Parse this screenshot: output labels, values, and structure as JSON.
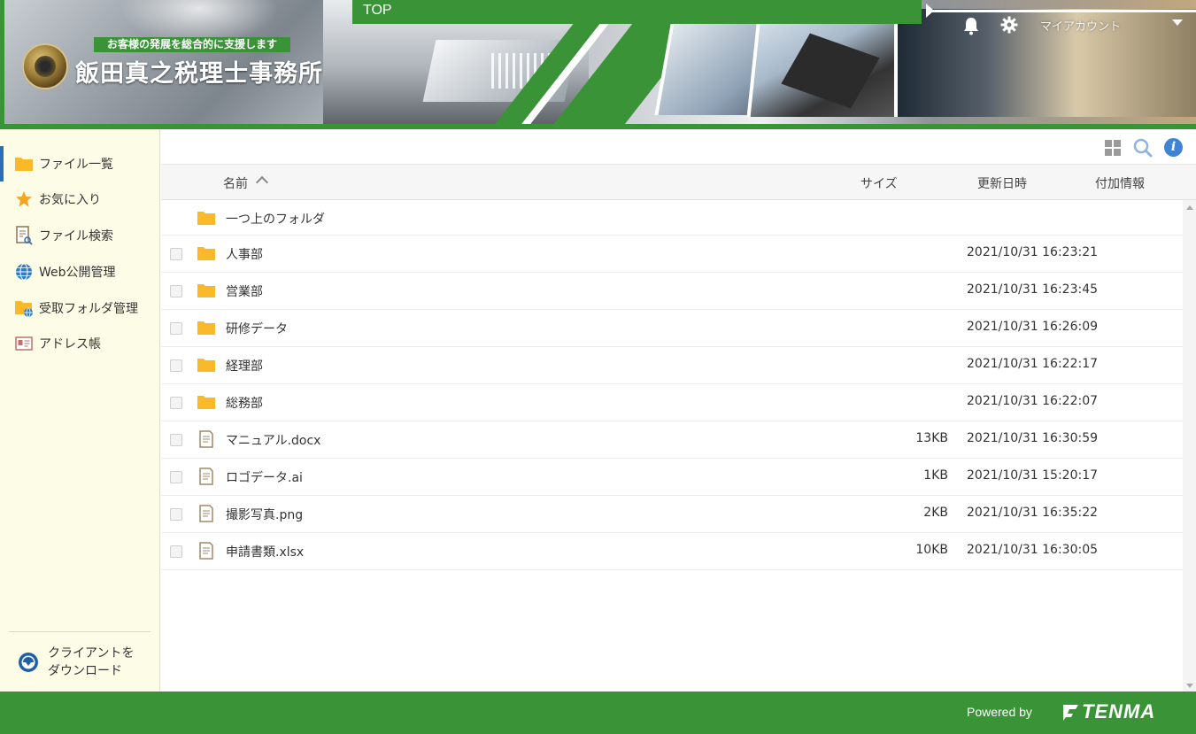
{
  "header": {
    "tagline": "お客様の発展を総合的に支援します",
    "company_name": "飯田真之税理士事務所",
    "breadcrumb": "TOP",
    "account_label": "マイアカウント"
  },
  "colors": {
    "brand_green": "#3a9437",
    "sidebar_bg": "#fdfde7",
    "folder_yellow": "#f9b928",
    "info_blue": "#3f84d4",
    "active_indicator": "#2a6fb8"
  },
  "sidebar": {
    "items": [
      {
        "label": "ファイル一覧",
        "icon": "folder-icon",
        "active": true
      },
      {
        "label": "お気に入り",
        "icon": "star-icon",
        "active": false
      },
      {
        "label": "ファイル検索",
        "icon": "file-search-icon",
        "active": false
      },
      {
        "label": "Web公開管理",
        "icon": "globe-icon",
        "active": false
      },
      {
        "label": "受取フォルダ管理",
        "icon": "folder-globe-icon",
        "active": false
      },
      {
        "label": "アドレス帳",
        "icon": "address-card-icon",
        "active": false
      }
    ],
    "download_line1": "クライアントを",
    "download_line2": "ダウンロード"
  },
  "table": {
    "columns": {
      "name": "名前",
      "size": "サイズ",
      "modified": "更新日時",
      "extra": "付加情報"
    },
    "parent_folder": "一つ上のフォルダ",
    "rows": [
      {
        "name": "人事部",
        "type": "folder",
        "size": "",
        "modified": "2021/10/31 16:23:21"
      },
      {
        "name": "営業部",
        "type": "folder",
        "size": "",
        "modified": "2021/10/31 16:23:45"
      },
      {
        "name": "研修データ",
        "type": "folder",
        "size": "",
        "modified": "2021/10/31 16:26:09"
      },
      {
        "name": "経理部",
        "type": "folder",
        "size": "",
        "modified": "2021/10/31 16:22:17"
      },
      {
        "name": "総務部",
        "type": "folder",
        "size": "",
        "modified": "2021/10/31 16:22:07"
      },
      {
        "name": "マニュアル.docx",
        "type": "file",
        "size": "13KB",
        "modified": "2021/10/31 16:30:59"
      },
      {
        "name": "ロゴデータ.ai",
        "type": "file",
        "size": "1KB",
        "modified": "2021/10/31 15:20:17"
      },
      {
        "name": "撮影写真.png",
        "type": "file",
        "size": "2KB",
        "modified": "2021/10/31 16:35:22"
      },
      {
        "name": "申請書類.xlsx",
        "type": "file",
        "size": "10KB",
        "modified": "2021/10/31 16:30:05"
      }
    ]
  },
  "footer": {
    "powered_by": "Powered by",
    "brand": "TENMA"
  }
}
